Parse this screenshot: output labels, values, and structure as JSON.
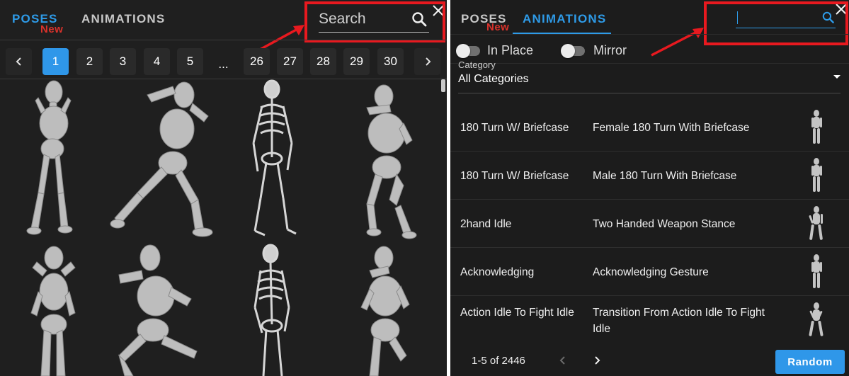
{
  "left": {
    "tabs": [
      {
        "label": "POSES",
        "active": true
      },
      {
        "label": "ANIMATIONS",
        "active": false
      }
    ],
    "new_badge": "New",
    "search": {
      "placeholder": "Search",
      "icon": "search-icon"
    },
    "pagination": {
      "prev_icon": "chevron-left-icon",
      "next_icon": "chevron-right-icon",
      "pages": [
        "1",
        "2",
        "3",
        "4",
        "5",
        "...",
        "26",
        "27",
        "28",
        "29",
        "30"
      ],
      "current": "1"
    },
    "poses": [
      {
        "name": "pose-mannequin-1"
      },
      {
        "name": "pose-mannequin-2"
      },
      {
        "name": "pose-skeleton-1"
      },
      {
        "name": "pose-mannequin-3"
      },
      {
        "name": "pose-mannequin-4"
      },
      {
        "name": "pose-mannequin-5"
      },
      {
        "name": "pose-skeleton-2"
      },
      {
        "name": "pose-mannequin-6"
      }
    ]
  },
  "right": {
    "tabs": [
      {
        "label": "POSES",
        "active": false
      },
      {
        "label": "ANIMATIONS",
        "active": true
      }
    ],
    "new_badge": "New",
    "search": {
      "value": "",
      "icon": "search-icon"
    },
    "toggles": [
      {
        "label": "In Place",
        "on": false
      },
      {
        "label": "Mirror",
        "on": false
      }
    ],
    "category": {
      "caption": "Category",
      "value": "All Categories"
    },
    "animations": [
      {
        "name": "180 Turn W/ Briefcase",
        "description": "Female 180 Turn With Briefcase"
      },
      {
        "name": "180 Turn W/ Briefcase",
        "description": "Male 180 Turn With Briefcase"
      },
      {
        "name": "2hand Idle",
        "description": "Two Handed Weapon Stance"
      },
      {
        "name": "Acknowledging",
        "description": "Acknowledging Gesture"
      },
      {
        "name": "Action Idle To Fight Idle",
        "description": "Transition From Action Idle To Fight Idle"
      }
    ],
    "footer": {
      "range": "1-5 of 2446",
      "random_label": "Random"
    }
  },
  "colors": {
    "accent": "#2f97e9",
    "highlight": "#e8191f",
    "badge": "#d9322b",
    "panel_bg": "#1f1f1f"
  }
}
